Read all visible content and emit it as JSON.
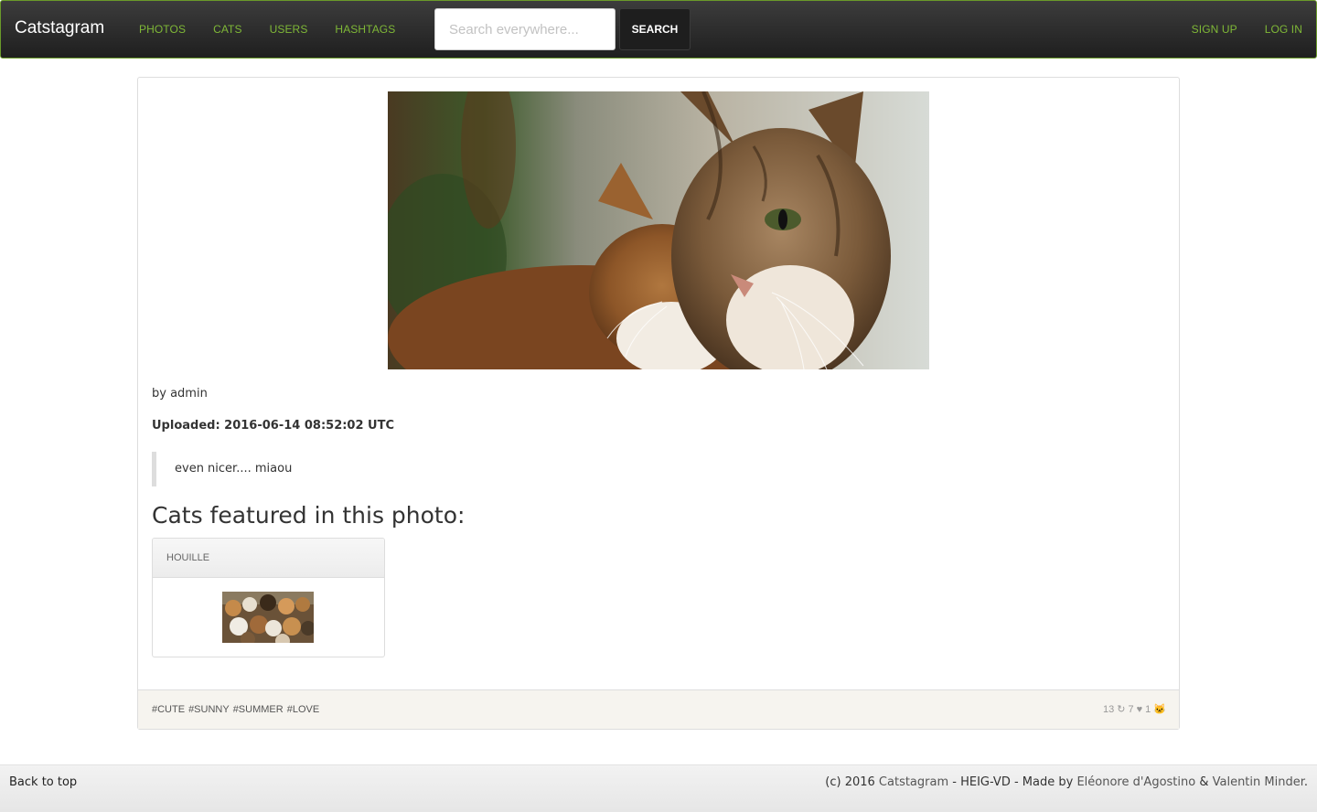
{
  "navbar": {
    "brand": "Catstagram",
    "links": [
      "Photos",
      "Cats",
      "Users",
      "Hashtags"
    ],
    "search_placeholder": "Search everywhere...",
    "search_button": "Search",
    "right_links": [
      "Sign up",
      "Log in"
    ]
  },
  "photo": {
    "author": "by admin",
    "uploaded": "Uploaded: 2016-06-14 08:52:02 UTC",
    "caption": "even nicer.... miaou"
  },
  "featured": {
    "title": "Cats featured in this photo:",
    "cats": [
      {
        "name": "Houille"
      }
    ]
  },
  "panel_footer": {
    "hashtags": [
      "#cute",
      "#sunny",
      "#summer",
      "#love"
    ],
    "views": "13",
    "repost_icon": "↻",
    "likes": "7",
    "heart_icon": "♥",
    "cats_count": "1",
    "cat_icon": "🐱"
  },
  "footer": {
    "back_to_top": "Back to top",
    "copyright_prefix": "(c) 2016 ",
    "site_name": "Catstagram",
    "org": " - HEIG-VD - Made by ",
    "author1": "Eléonore d'Agostino",
    "amp": " & ",
    "author2": "Valentin Minder",
    "end": "."
  },
  "colors": {
    "nav_link": "#7fb837",
    "nav_border": "#6a9a2a",
    "panel_footer_bg": "#f6f4ef"
  }
}
